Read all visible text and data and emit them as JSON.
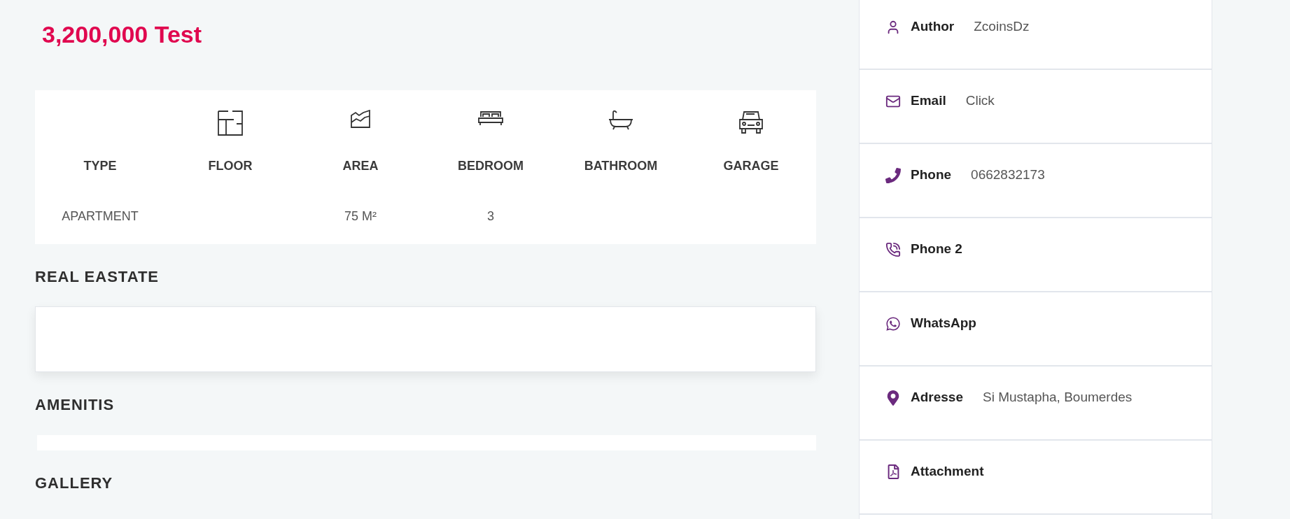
{
  "price": "3,200,000 Test",
  "specs": [
    {
      "label": "TYPE",
      "kind": "text",
      "value": "APARTMENT"
    },
    {
      "label": "FLOOR",
      "kind": "floorplan"
    },
    {
      "label": "AREA",
      "kind": "area",
      "value": "75 M²"
    },
    {
      "label": "BEDROOM",
      "kind": "bed",
      "value": "3"
    },
    {
      "label": "BATHROOM",
      "kind": "bath"
    },
    {
      "label": "GARAGE",
      "kind": "car"
    }
  ],
  "sections": [
    {
      "title": "REAL EASTATE",
      "kind": "card"
    },
    {
      "title": "AMENITIS",
      "kind": "strip"
    },
    {
      "title": "GALLERY",
      "kind": "none"
    }
  ],
  "contact": [
    {
      "kind": "user",
      "label": "Author",
      "value": "ZcoinsDz"
    },
    {
      "kind": "mail",
      "label": "Email",
      "value": "Click"
    },
    {
      "kind": "phone",
      "label": "Phone",
      "value": "0662832173"
    },
    {
      "kind": "phone2",
      "label": "Phone 2"
    },
    {
      "kind": "whatsapp",
      "label": "WhatsApp"
    },
    {
      "kind": "pin",
      "label": "Adresse",
      "value": "Si Mustapha, Boumerdes"
    },
    {
      "kind": "pdf",
      "label": "Attachment"
    }
  ]
}
